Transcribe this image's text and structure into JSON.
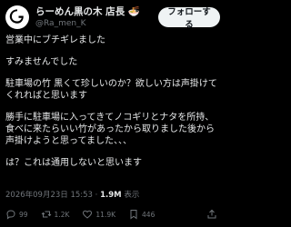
{
  "author": {
    "display_name": "らーめん黒の木 店長 🍜",
    "handle": "@Ra_men_K"
  },
  "follow_button": "フォローする",
  "post": {
    "lines": [
      "営業中にブチギレました",
      "",
      "すみませんでした",
      "",
      "駐車場の竹 黒くて珍しいのか？欲しい方は声掛けてくれればと思います",
      "",
      "勝手に駐車場に入ってきてノコギリとナタを所持、食べに来たらいい竹があったから取りました後から声掛けようと思ってました、、、",
      "",
      "は？これは通用しないと思います"
    ]
  },
  "meta": {
    "timestamp": "2026年09月23日 15:53",
    "separator": "·",
    "views_count": "1.9M",
    "views_label": "表示"
  },
  "actions": {
    "reply": "99",
    "retweet": "1.2K",
    "like": "11.9K",
    "bookmark": "446"
  }
}
